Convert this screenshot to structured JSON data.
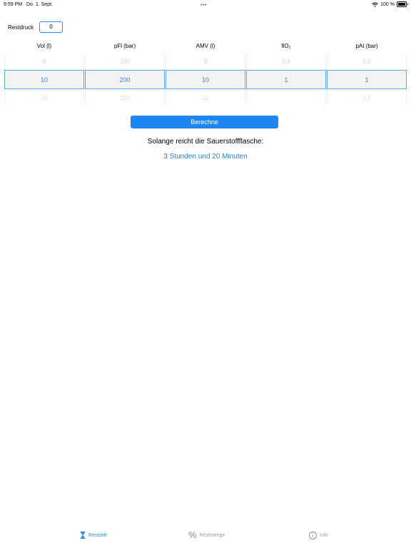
{
  "status": {
    "time": "9:59 PM",
    "date": "Do. 1. Sept.",
    "battery": "100 %",
    "dots": "•••"
  },
  "restdruck": {
    "label": "Restdruck",
    "value": "0"
  },
  "columns": [
    {
      "header": "Vol (l)",
      "above": "8",
      "selected": "10",
      "below": "15"
    },
    {
      "header": "pFl (bar)",
      "above": "190",
      "selected": "200",
      "below": "210"
    },
    {
      "header": "AMV (l)",
      "above": "9",
      "selected": "10",
      "below": "11"
    },
    {
      "header": "fiO₂",
      "above": "0,9",
      "selected": "1",
      "below": ""
    },
    {
      "header": "pAt (bar)",
      "above": "0,9",
      "selected": "1",
      "below": "1,1"
    }
  ],
  "button": {
    "label": "Berechne"
  },
  "result": {
    "label": "Solange reicht die Sauerstoffflasche:",
    "value": "3 Stunden und 20 Minuten"
  },
  "tabs": [
    {
      "label": "Restzeit",
      "icon": "hourglass-icon",
      "active": true
    },
    {
      "label": "Restmenge",
      "icon": "percent-icon",
      "active": false
    },
    {
      "label": "Info",
      "icon": "info-icon",
      "active": false
    }
  ],
  "colors": {
    "accent": "#1c86f2",
    "selectionBorder": "#5ea6ef"
  }
}
